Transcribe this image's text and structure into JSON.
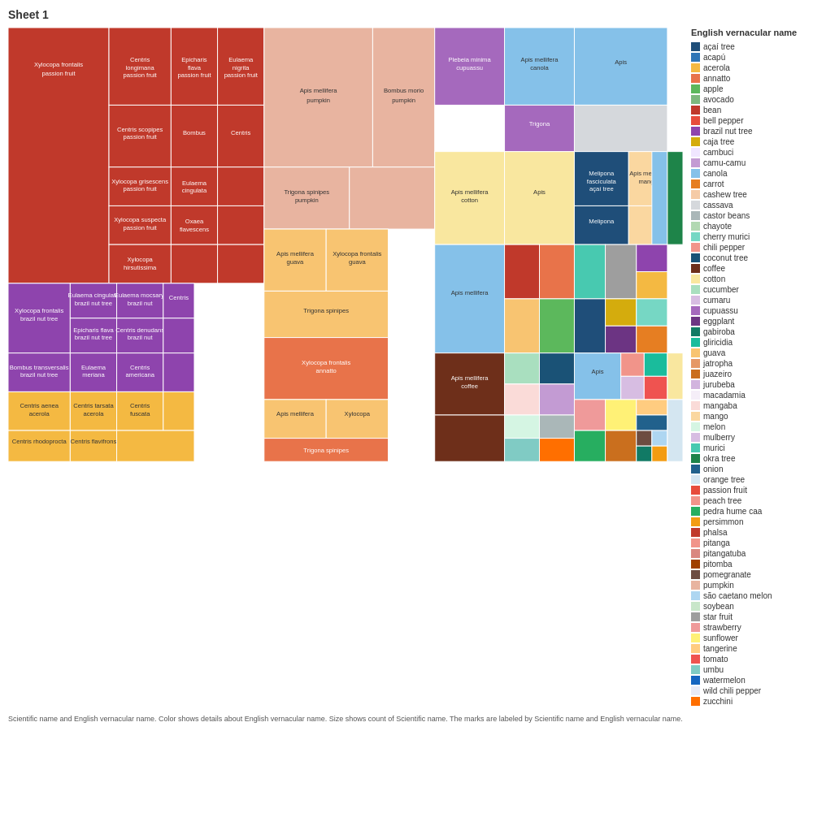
{
  "title": "Sheet 1",
  "caption": "Scientific name and English vernacular name.  Color shows details about English vernacular name.  Size shows count of Scientific name.  The marks are labeled by Scientific name and English vernacular name.",
  "legend": {
    "title": "English vernacular name",
    "items": [
      {
        "label": "açaí tree",
        "color": "#1f4e79"
      },
      {
        "label": "acapú",
        "color": "#2e75b6"
      },
      {
        "label": "acerola",
        "color": "#f4b942"
      },
      {
        "label": "annatto",
        "color": "#e8734a"
      },
      {
        "label": "apple",
        "color": "#5cb85c"
      },
      {
        "label": "avocado",
        "color": "#7db87d"
      },
      {
        "label": "bean",
        "color": "#c0392b"
      },
      {
        "label": "bell pepper",
        "color": "#e74c3c"
      },
      {
        "label": "brazil nut tree",
        "color": "#8e44ad"
      },
      {
        "label": "caja tree",
        "color": "#d4ac0d"
      },
      {
        "label": "cambuci",
        "color": "#f0e6ff"
      },
      {
        "label": "camu-camu",
        "color": "#c39bd3"
      },
      {
        "label": "canola",
        "color": "#85c1e9"
      },
      {
        "label": "carrot",
        "color": "#e67e22"
      },
      {
        "label": "cashew tree",
        "color": "#f5cba7"
      },
      {
        "label": "cassava",
        "color": "#d5d8dc"
      },
      {
        "label": "castor beans",
        "color": "#aab7b8"
      },
      {
        "label": "chayote",
        "color": "#b2d8b2"
      },
      {
        "label": "cherry murici",
        "color": "#76d7c4"
      },
      {
        "label": "chili pepper",
        "color": "#f1948a"
      },
      {
        "label": "coconut tree",
        "color": "#1a5276"
      },
      {
        "label": "coffee",
        "color": "#6e2f1a"
      },
      {
        "label": "cotton",
        "color": "#f9e79f"
      },
      {
        "label": "cucumber",
        "color": "#a9dfbf"
      },
      {
        "label": "cumaru",
        "color": "#d7bde2"
      },
      {
        "label": "cupuassu",
        "color": "#a569bd"
      },
      {
        "label": "eggplant",
        "color": "#6c3483"
      },
      {
        "label": "gabiroba",
        "color": "#117a65"
      },
      {
        "label": "gliricidia",
        "color": "#1abc9c"
      },
      {
        "label": "guava",
        "color": "#f8c471"
      },
      {
        "label": "jatropha",
        "color": "#e59866"
      },
      {
        "label": "juazeiro",
        "color": "#ca6f1e"
      },
      {
        "label": "jurubeba",
        "color": "#d2b4de"
      },
      {
        "label": "macadamia",
        "color": "#f5eef8"
      },
      {
        "label": "mangaba",
        "color": "#fadbd8"
      },
      {
        "label": "mango",
        "color": "#fad7a0"
      },
      {
        "label": "melon",
        "color": "#d5f5e3"
      },
      {
        "label": "mulberry",
        "color": "#d7bde2"
      },
      {
        "label": "murici",
        "color": "#48c9b0"
      },
      {
        "label": "okra tree",
        "color": "#1e8449"
      },
      {
        "label": "onion",
        "color": "#21618c"
      },
      {
        "label": "orange tree",
        "color": "#d4e6f1"
      },
      {
        "label": "passion fruit",
        "color": "#e74c3c"
      },
      {
        "label": "peach tree",
        "color": "#f1948a"
      },
      {
        "label": "pedra hume caa",
        "color": "#27ae60"
      },
      {
        "label": "persimmon",
        "color": "#f39c12"
      },
      {
        "label": "phalsa",
        "color": "#c0392b"
      },
      {
        "label": "pitanga",
        "color": "#f1948a"
      },
      {
        "label": "pitangatuba",
        "color": "#d98880"
      },
      {
        "label": "pitomba",
        "color": "#a04000"
      },
      {
        "label": "pomegranate",
        "color": "#6d4c41"
      },
      {
        "label": "pumpkin",
        "color": "#e8b4a0"
      },
      {
        "label": "são caetano melon",
        "color": "#aed6f1"
      },
      {
        "label": "soybean",
        "color": "#c8e6c9"
      },
      {
        "label": "star fruit",
        "color": "#9e9e9e"
      },
      {
        "label": "strawberry",
        "color": "#ef9a9a"
      },
      {
        "label": "sunflower",
        "color": "#fff176"
      },
      {
        "label": "tangerine",
        "color": "#ffcc80"
      },
      {
        "label": "tomato",
        "color": "#ef5350"
      },
      {
        "label": "umbu",
        "color": "#80cbc4"
      },
      {
        "label": "watermelon",
        "color": "#1565c0"
      },
      {
        "label": "wild chili pepper",
        "color": "#e8eaf6"
      },
      {
        "label": "zucchini",
        "color": "#ff6f00"
      }
    ]
  }
}
